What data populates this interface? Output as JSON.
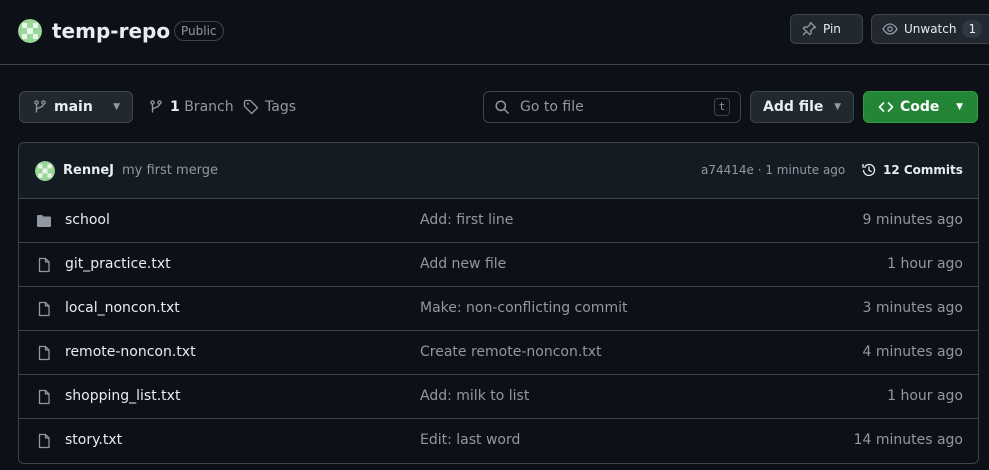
{
  "header": {
    "repo_name": "temp-repo",
    "visibility": "Public",
    "pin_label": "Pin",
    "unwatch_label": "Unwatch",
    "watch_count": "1"
  },
  "toolbar": {
    "branch": "main",
    "branch_count": "1",
    "branch_label": "Branch",
    "tags_label": "Tags",
    "goto_placeholder": "Go to file",
    "goto_shortcut": "t",
    "add_file_label": "Add file",
    "code_label": "Code"
  },
  "latest_commit": {
    "author": "RenneJ",
    "message": "my first merge",
    "meta": "a74414e · 1 minute ago",
    "commits_label": "12 Commits"
  },
  "files": [
    {
      "name": "school",
      "type": "folder",
      "message": "Add: first line",
      "time": "9 minutes ago"
    },
    {
      "name": "git_practice.txt",
      "type": "file",
      "message": "Add new file",
      "time": "1 hour ago"
    },
    {
      "name": "local_noncon.txt",
      "type": "file",
      "message": "Make: non-conflicting commit",
      "time": "3 minutes ago"
    },
    {
      "name": "remote-noncon.txt",
      "type": "file",
      "message": "Create remote-noncon.txt",
      "time": "4 minutes ago"
    },
    {
      "name": "shopping_list.txt",
      "type": "file",
      "message": "Add: milk to list",
      "time": "1 hour ago"
    },
    {
      "name": "story.txt",
      "type": "file",
      "message": "Edit: last word",
      "time": "14 minutes ago"
    }
  ],
  "colors": {
    "background": "#0d1117",
    "border": "#3d444d",
    "muted_text": "#9198a1",
    "code_button": "#238636"
  }
}
